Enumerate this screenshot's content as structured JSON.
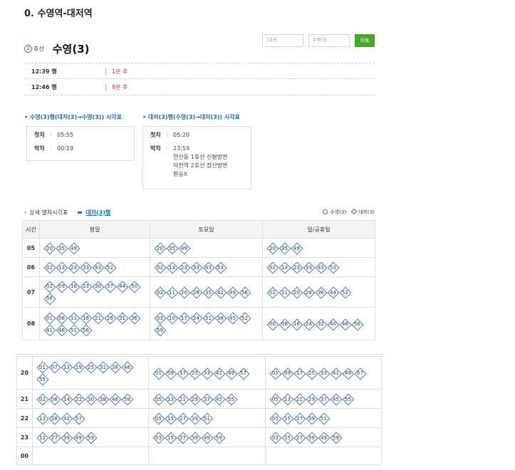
{
  "page": {
    "heading": "0. 수영역-대저역"
  },
  "station": {
    "line_number": "3",
    "line_label": "호선",
    "name": "수영(3)"
  },
  "controls": {
    "line_select": "1호선",
    "station_select": "수영(3)",
    "go_label": "이동"
  },
  "arrivals": [
    {
      "time": "12:39 행",
      "remain": "1분 후"
    },
    {
      "time": "12:46 행",
      "remain": "8분 후"
    }
  ],
  "timetables": {
    "left": {
      "title": "수영(3)행(대저(3)→수영(3)) 시각표",
      "first_label": "첫차",
      "first_value": "05:55",
      "last_label": "막차",
      "last_value": "00:19"
    },
    "right": {
      "title": "대저(3)행(수영(3)→대저(3)) 시각표",
      "first_label": "첫차",
      "first_value": "05:20",
      "last_label": "막차",
      "last_value": "23:59",
      "notes": [
        "연산동 1호선 신평방면",
        "덕천역 2호선 장산방면",
        "환승X"
      ]
    }
  },
  "detail": {
    "label": "상세 열차시각표",
    "tab": "대저(3)행",
    "legend_circle": "수영(3)",
    "legend_diamond": "대저(3)"
  },
  "table": {
    "headers": [
      "시간",
      "평일",
      "토요일",
      "일/공휴일"
    ],
    "rows_top": [
      {
        "hour": "05",
        "weekday": [
          "20",
          "35",
          "49"
        ],
        "saturday": [
          "20",
          "35",
          "49"
        ],
        "holiday": [
          "20",
          "35",
          "49"
        ]
      },
      {
        "hour": "06",
        "weekday": [
          "02",
          "13",
          "23",
          "33",
          "43",
          "52"
        ],
        "saturday": [
          "02",
          "13",
          "23",
          "33",
          "43",
          "53"
        ],
        "holiday": [
          "02",
          "13",
          "23",
          "33",
          "43",
          "53"
        ]
      },
      {
        "hour": "07",
        "weekday": [
          "02",
          "09",
          "16",
          "23",
          "30",
          "37",
          "44",
          "50",
          "56"
        ],
        "saturday": [
          "02",
          "11",
          "20",
          "28",
          "35",
          "42",
          "49",
          "56"
        ],
        "holiday": [
          "02",
          "11",
          "20",
          "28",
          "36",
          "44",
          "52"
        ]
      },
      {
        "hour": "08",
        "weekday": [
          "01",
          "06",
          "11",
          "16",
          "21",
          "26",
          "31",
          "36",
          "41",
          "46",
          "51",
          "56"
        ],
        "saturday": [
          "03",
          "10",
          "17",
          "24",
          "31",
          "38",
          "45",
          "52",
          "59"
        ],
        "holiday": [
          "00",
          "08",
          "16",
          "24",
          "32",
          "40",
          "48",
          "56"
        ]
      }
    ],
    "rows_bottom": [
      {
        "hour": "20",
        "weekday": [
          "01",
          "07",
          "13",
          "19",
          "25",
          "31",
          "38",
          "46",
          "55"
        ],
        "saturday": [
          "01",
          "09",
          "17",
          "25",
          "33",
          "41",
          "49",
          "57"
        ],
        "holiday": [
          "01",
          "09",
          "17",
          "25",
          "33",
          "41",
          "49",
          "57"
        ]
      },
      {
        "hour": "21",
        "weekday": [
          "02",
          "08",
          "14",
          "22",
          "30",
          "38",
          "46",
          "58"
        ],
        "saturday": [
          "05",
          "13",
          "21",
          "29",
          "37",
          "45",
          "55"
        ],
        "holiday": [
          "05",
          "13",
          "21",
          "29",
          "37",
          "45",
          "55"
        ]
      },
      {
        "hour": "22",
        "weekday": [
          "13",
          "28",
          "42",
          "57"
        ],
        "saturday": [
          "05",
          "15",
          "27",
          "39",
          "51"
        ],
        "holiday": [
          "05",
          "15",
          "27",
          "39",
          "51"
        ]
      },
      {
        "hour": "23",
        "weekday": [
          "12",
          "27",
          "39",
          "49",
          "59"
        ],
        "saturday": [
          "03",
          "15",
          "27",
          "39",
          "49",
          "59"
        ],
        "holiday": [
          "03",
          "15",
          "27",
          "39",
          "49",
          "59"
        ]
      },
      {
        "hour": "00",
        "weekday": [],
        "saturday": [],
        "holiday": []
      }
    ]
  },
  "colors": {
    "line3": "#3aa037",
    "accent": "#1c6fb5",
    "remain": "#c0392b",
    "go": "#4aa626"
  }
}
